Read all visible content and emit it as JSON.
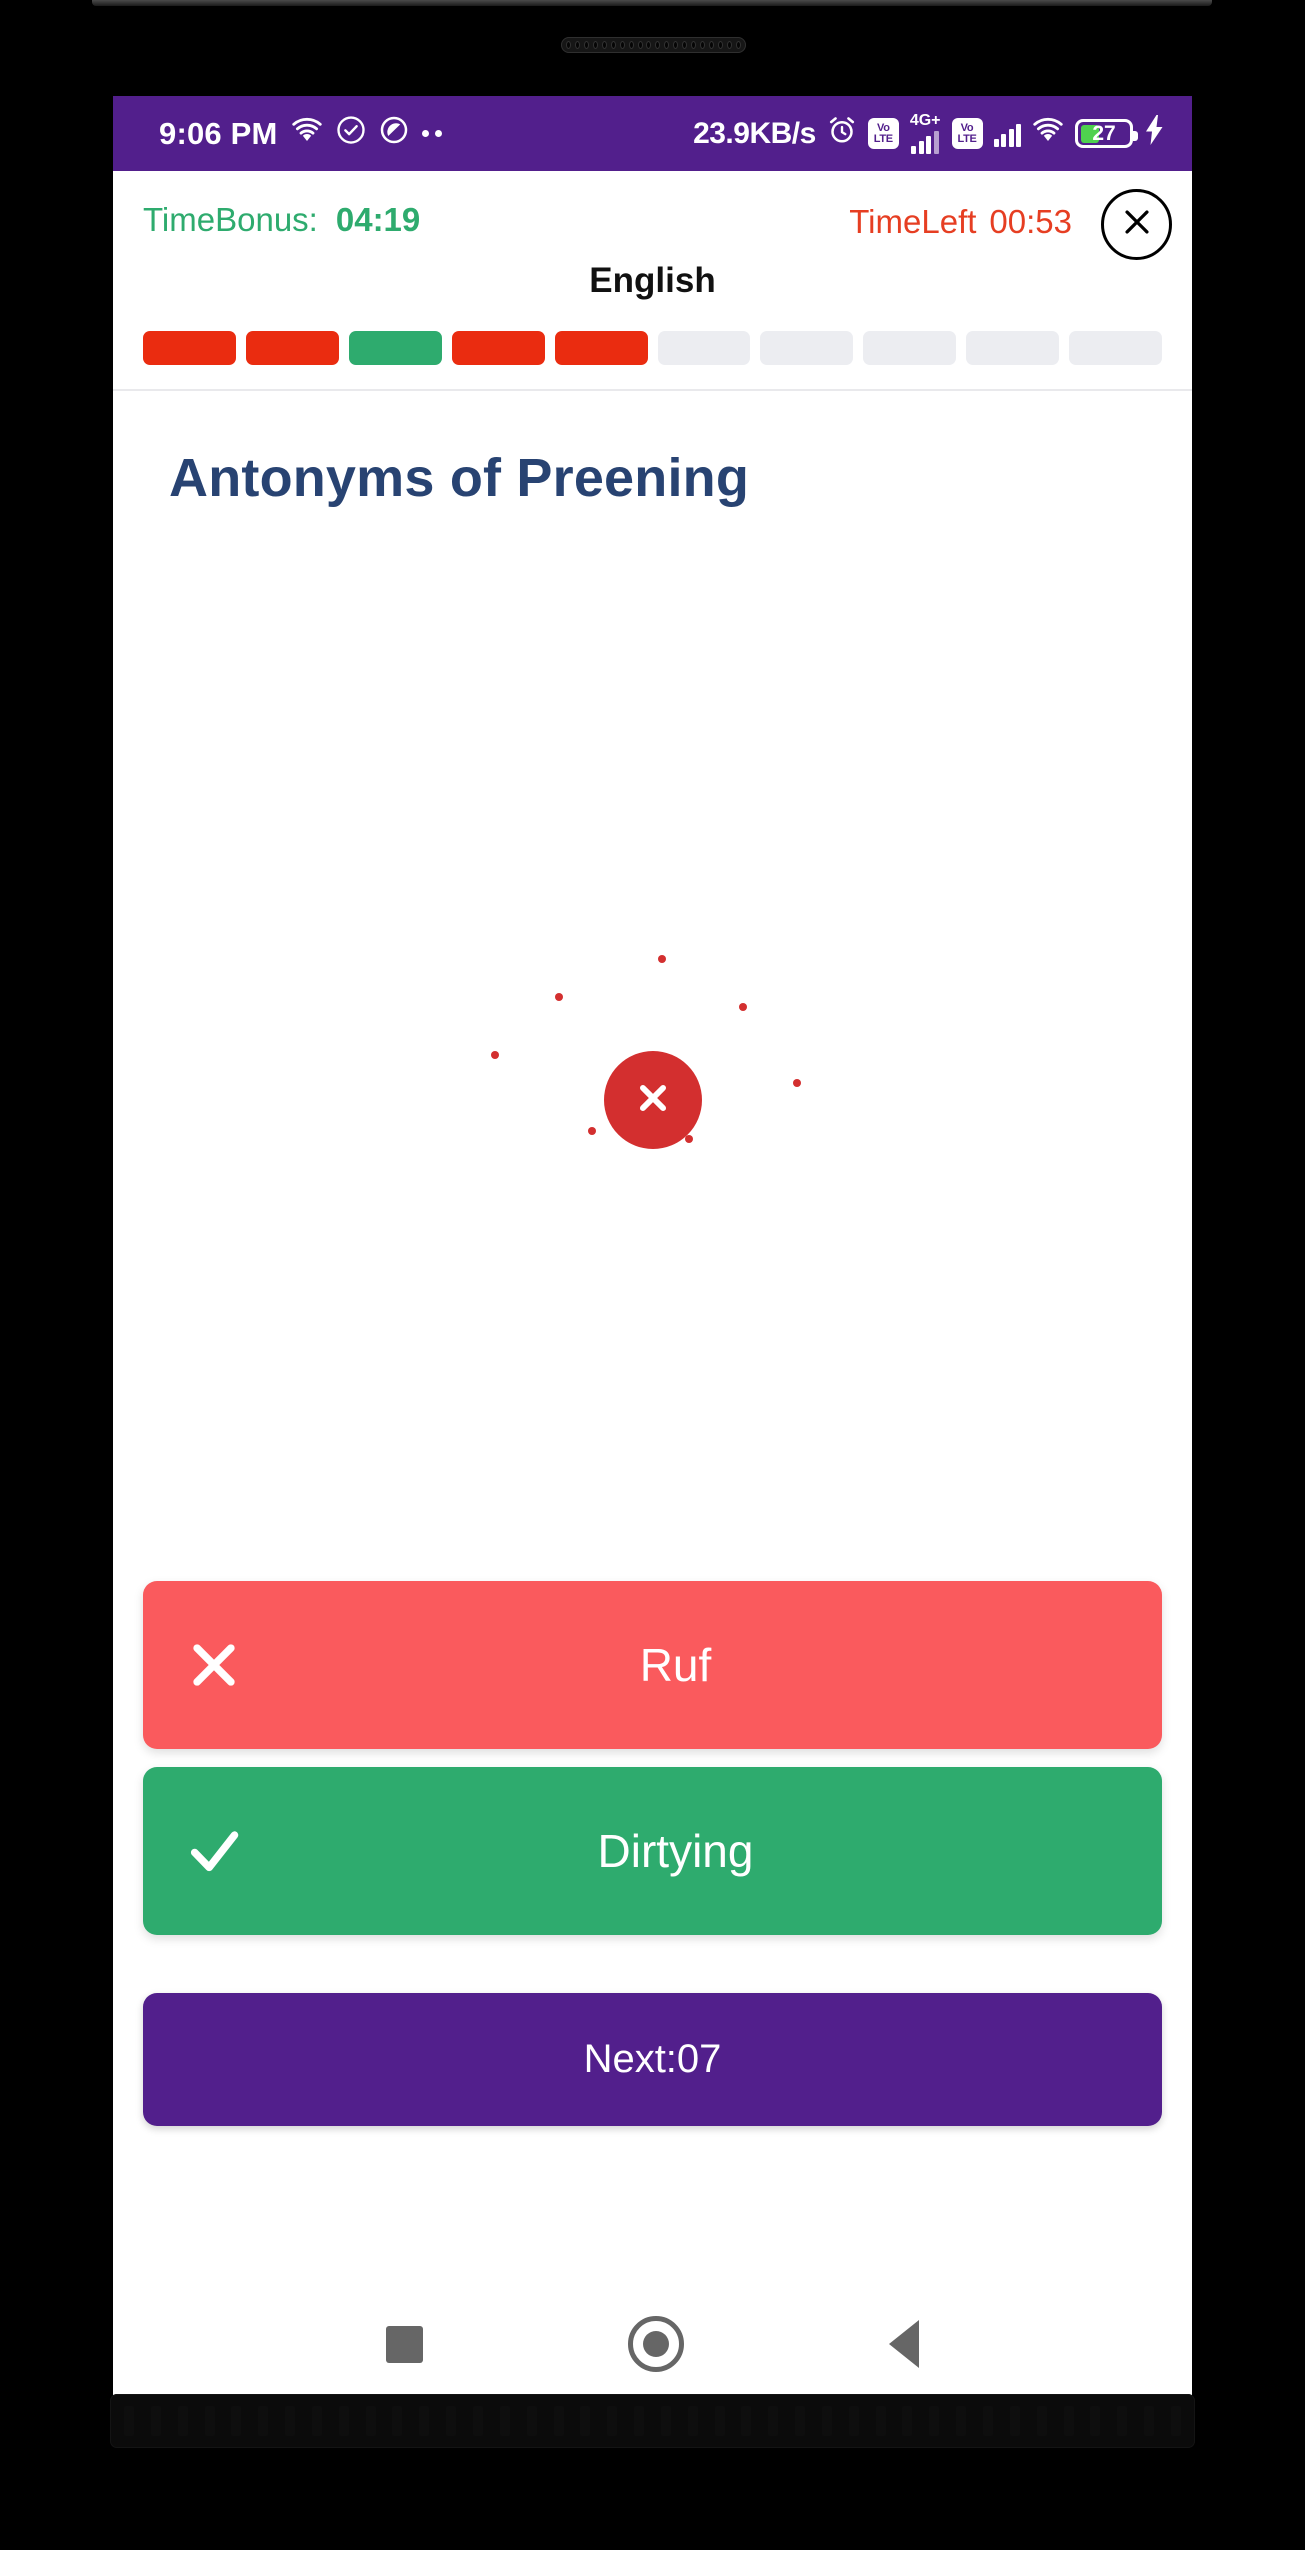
{
  "status_bar": {
    "clock": "9:06 PM",
    "network_speed": "23.9KB/s",
    "battery_percent": "27",
    "volte_line1": "Vo",
    "volte_line2": "LTE",
    "network_type": "4G+",
    "icons": [
      "wifi-icon",
      "check-circle-icon",
      "do-not-disturb-icon",
      "more-dots-icon",
      "alarm-icon",
      "volte-icon",
      "signal-icon",
      "volte-icon",
      "signal-icon",
      "wifi-icon",
      "battery-icon",
      "charging-bolt-icon"
    ],
    "accent_bg": "#521f8c"
  },
  "quiz_header": {
    "time_bonus_label": "TimeBonus:",
    "time_bonus_value": "04:19",
    "time_left_label": "TimeLeft",
    "time_left_value": "00:53",
    "subject": "English",
    "close_label": "Close",
    "time_bonus_color": "#2eab6e",
    "time_left_color": "#e63e22"
  },
  "progress": {
    "segments": [
      "wrong",
      "wrong",
      "correct",
      "wrong",
      "wrong",
      "empty",
      "empty",
      "empty",
      "empty",
      "empty"
    ],
    "colors": {
      "wrong": "#ea2c10",
      "correct": "#2eab6e",
      "empty": "#ecedf1"
    }
  },
  "question": {
    "text": "Antonyms of Preening",
    "text_color": "#284372"
  },
  "result": {
    "state": "wrong",
    "icon": "x-mark-icon",
    "circle_color": "#d32f2f"
  },
  "answers": [
    {
      "label": "Ruf",
      "state": "wrong",
      "mark": "x-mark-icon",
      "color": "#fa5a5d"
    },
    {
      "label": "Dirtying",
      "state": "correct",
      "mark": "check-mark-icon",
      "color": "#2eab6e"
    }
  ],
  "next_button": {
    "label": "Next:07",
    "color": "#521f8c"
  },
  "nav_bar": {
    "recents": "recents-square-icon",
    "home": "home-circle-icon",
    "back": "back-triangle-icon"
  }
}
